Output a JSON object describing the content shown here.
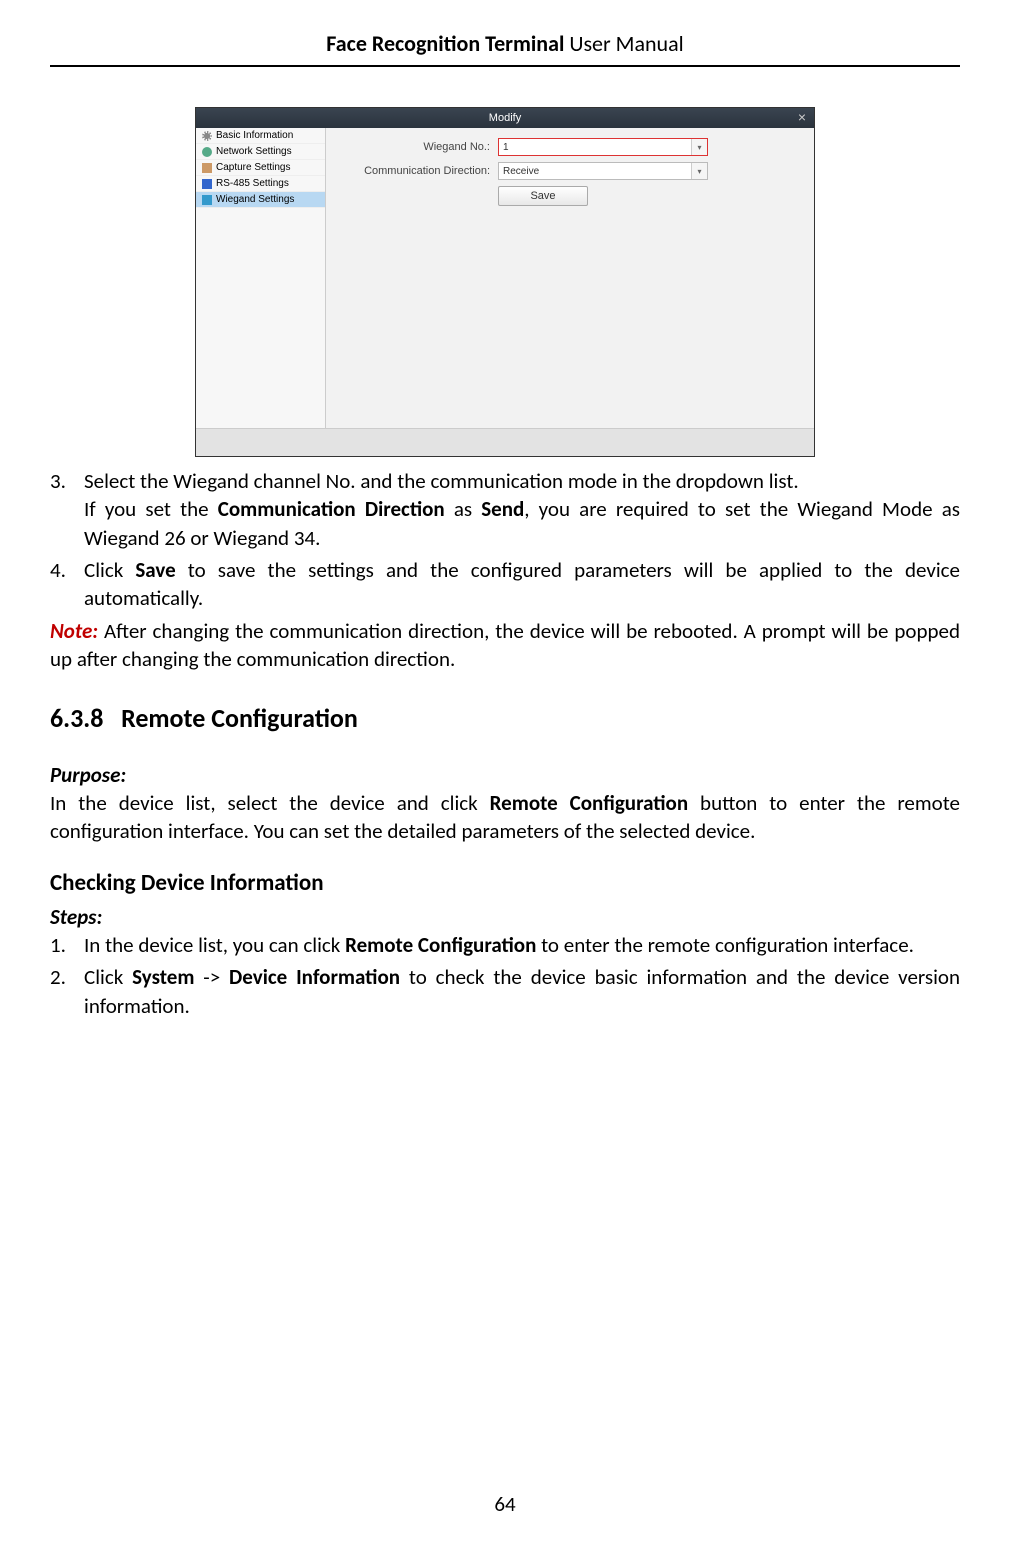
{
  "header": {
    "bold": "Face Recognition Terminal",
    "plain": " User Manual"
  },
  "screenshot": {
    "title": "Modify",
    "close": "×",
    "side": {
      "items": [
        {
          "label": "Basic Information"
        },
        {
          "label": "Network Settings"
        },
        {
          "label": "Capture Settings"
        },
        {
          "label": "RS-485 Settings"
        },
        {
          "label": "Wiegand Settings"
        }
      ]
    },
    "form": {
      "wiegand_label": "Wiegand No.:",
      "wiegand_value": "1",
      "direction_label": "Communication Direction:",
      "direction_value": "Receive",
      "save_label": "Save",
      "caret": "▾"
    }
  },
  "steps_a": {
    "item3_num": "3.",
    "item3_line1": "Select the Wiegand channel No. and the communication mode in the dropdown list.",
    "item3_line2_a": "If you set the ",
    "item3_line2_b": "Communication Direction",
    "item3_line2_c": " as ",
    "item3_line2_d": "Send",
    "item3_line2_e": ", you are required to set the Wiegand Mode as Wiegand 26 or Wiegand 34.",
    "item4_num": "4.",
    "item4_a": "Click ",
    "item4_b": "Save",
    "item4_c": " to save the settings and the configured parameters will be applied to the device automatically."
  },
  "note": {
    "label": "Note:",
    "text": " After changing the communication direction, the device will be rebooted. A prompt will be popped up after changing the communication direction."
  },
  "h2": {
    "num": "6.3.8",
    "title": " Remote Configuration"
  },
  "purpose_label": "Purpose:",
  "purpose_text_a": "In the device list, select the device and click ",
  "purpose_text_b": "Remote Configuration",
  "purpose_text_c": " button to enter the remote configuration interface. You can set the detailed parameters of the selected device.",
  "h3": "Checking Device Information",
  "steps_label": "Steps:",
  "steps_b": {
    "item1_num": "1.",
    "item1_a": "In the device list, you can click ",
    "item1_b": "Remote Configuration",
    "item1_c": " to enter the remote configuration interface.",
    "item2_num": "2.",
    "item2_a": "Click ",
    "item2_b": "System",
    "item2_c": " -> ",
    "item2_d": "Device Information",
    "item2_e": " to check the device basic information and the device version information."
  },
  "page_number": "64"
}
